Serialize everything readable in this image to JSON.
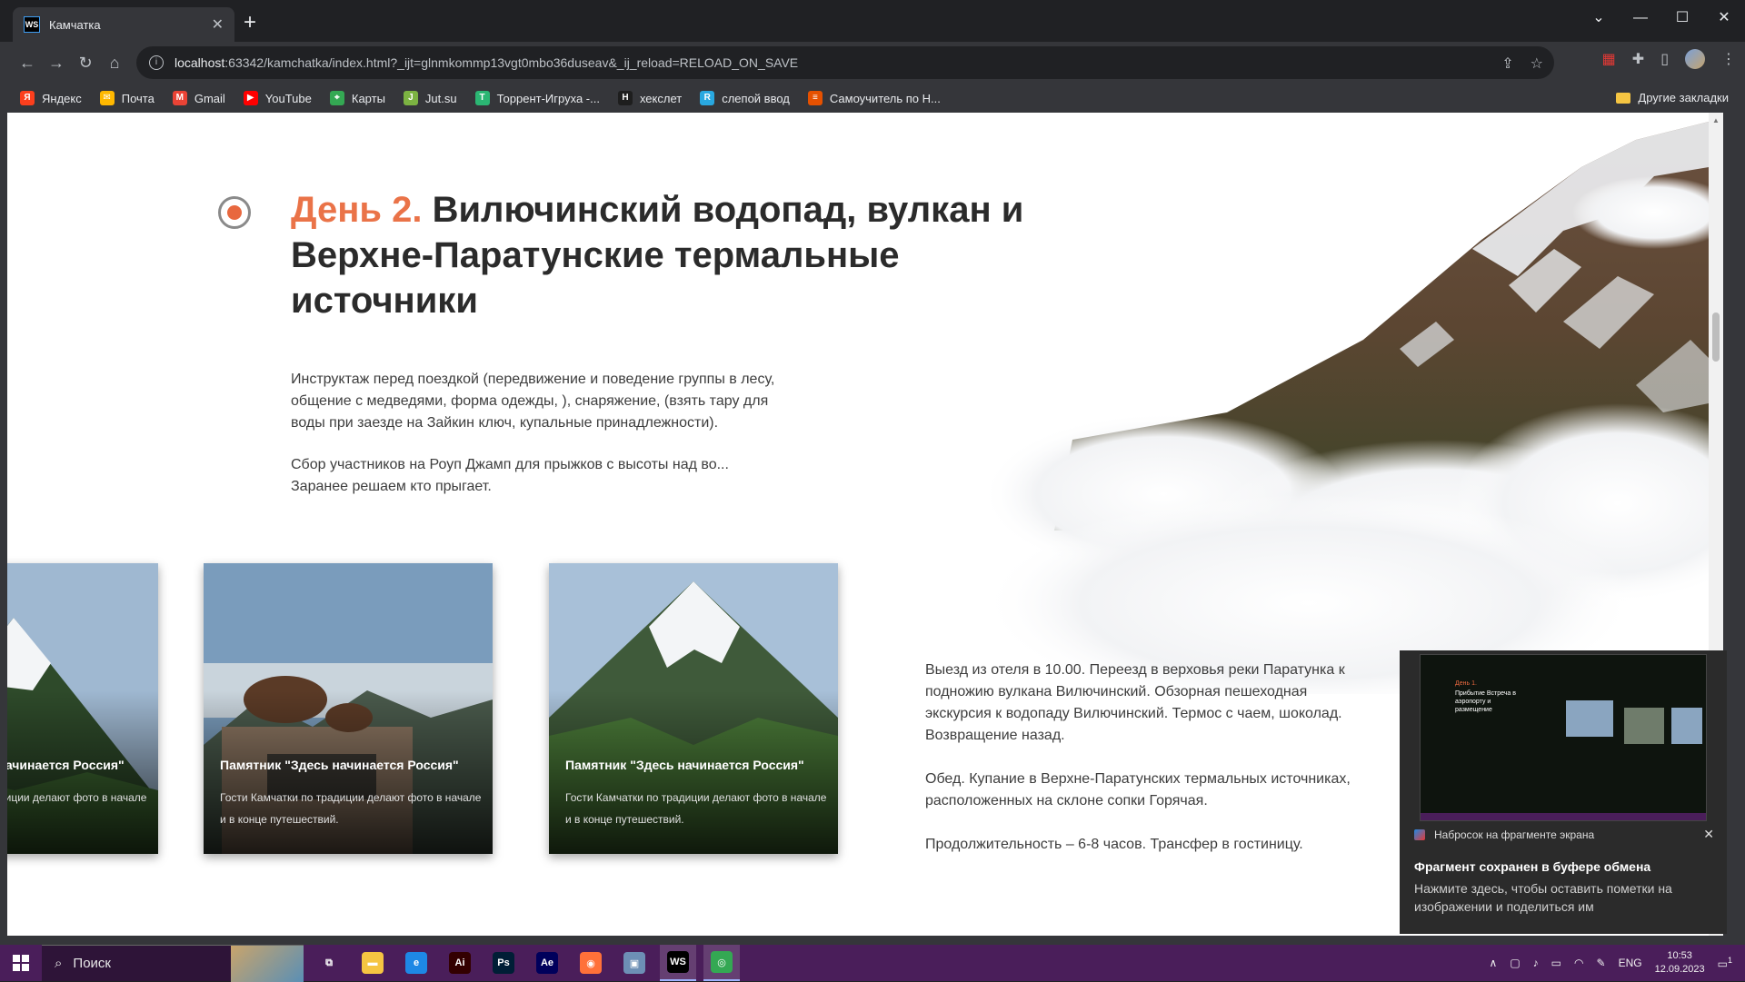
{
  "browser": {
    "tab_title": "Камчатка",
    "tab_favicon": "WS",
    "url_host": "localhost",
    "url_rest": ":63342/kamchatka/index.html?_ijt=glnmkommp13vgt0mbo36duseav&_ij_reload=RELOAD_ON_SAVE",
    "bookmarks": [
      {
        "label": "Яндекс",
        "icon": "Я",
        "color": "#fc3f1d"
      },
      {
        "label": "Почта",
        "icon": "✉",
        "color": "#ffb800"
      },
      {
        "label": "Gmail",
        "icon": "M",
        "color": "#ea4335"
      },
      {
        "label": "YouTube",
        "icon": "▶",
        "color": "#ff0000"
      },
      {
        "label": "Карты",
        "icon": "⌖",
        "color": "#34a853"
      },
      {
        "label": "Jut.su",
        "icon": "J",
        "color": "#7cb342"
      },
      {
        "label": "Торрент-Игруха -...",
        "icon": "T",
        "color": "#2bb673"
      },
      {
        "label": "хекслет",
        "icon": "H",
        "color": "#1e1e1e"
      },
      {
        "label": "слепой ввод",
        "icon": "R",
        "color": "#29a8e0"
      },
      {
        "label": "Самоучитель по Н...",
        "icon": "≡",
        "color": "#e65100"
      }
    ],
    "other_bookmarks": "Другие закладки"
  },
  "page": {
    "day_label": "День 2.",
    "title": "Вилючинский водопад, вулкан и Верхне-Паратунские термальные источники",
    "intro_1": "Инструктаж перед поездкой (передвижение и поведение группы в лесу, общение с медведями, форма одежды, ), снаряжение, (взять тару для воды при заезде на Зайкин ключ, купальные принадлежности).",
    "intro_2": "Сбор участников на Роуп Джамп для прыжков с высоты над во... Заранее решаем кто прыгает.",
    "cards": [
      {
        "title": "Памятник \"Здесь начинается Россия\"",
        "desc": "Гости Камчатки по традиции делают фото в начале и в конце путешествий."
      },
      {
        "title": "Памятник \"Здесь начинается Россия\"",
        "desc": "Гости Камчатки по традиции делают фото в начале и в конце путешествий."
      },
      {
        "title": "Памятник \"Здесь начинается Россия\"",
        "desc": "Гости Камчатки по традиции делают фото в начале и в конце путешествий."
      }
    ],
    "detail_1": "Выезд из отеля в 10.00. Переезд в верховья реки Паратунка к подножию вулкана Вилючинский. Обзорная пешеходная экскурсия к водопаду Вилючинский. Термос с чаем, шоколад. Возвращение назад.",
    "detail_2": "Обед. Купание в Верхне-Паратунских термальных источниках, расположенных на склоне сопки Горячая.",
    "detail_3": "Продолжительность – 6-8 часов. Трансфер в гостиницу."
  },
  "notification": {
    "app": "Набросок на фрагменте экрана",
    "heading": "Фрагмент сохранен в буфере обмена",
    "body": "Нажмите здесь, чтобы оставить пометки на изображении и поделиться им",
    "thumb_day": "День 1.",
    "thumb_title": "Прибытие Встреча в аэропорту и размещение"
  },
  "taskbar": {
    "search_placeholder": "Поиск",
    "lang": "ENG",
    "time": "10:53",
    "date": "12.09.2023",
    "notif_count": "1",
    "apps": [
      {
        "name": "task-view-icon",
        "label": "⧉",
        "color": "transparent"
      },
      {
        "name": "file-explorer-icon",
        "label": "▬",
        "color": "#f5c542"
      },
      {
        "name": "edge-icon",
        "label": "e",
        "color": "#1e88e5"
      },
      {
        "name": "illustrator-icon",
        "label": "Ai",
        "color": "#330000"
      },
      {
        "name": "photoshop-icon",
        "label": "Ps",
        "color": "#001e36"
      },
      {
        "name": "after-effects-icon",
        "label": "Ae",
        "color": "#00005b"
      },
      {
        "name": "firefox-icon",
        "label": "◉",
        "color": "#ff7139"
      },
      {
        "name": "image-viewer-icon",
        "label": "▣",
        "color": "#6d8fb5"
      },
      {
        "name": "webstorm-icon",
        "label": "WS",
        "color": "#000000"
      },
      {
        "name": "chrome-icon",
        "label": "◎",
        "color": "#34a853"
      }
    ]
  }
}
